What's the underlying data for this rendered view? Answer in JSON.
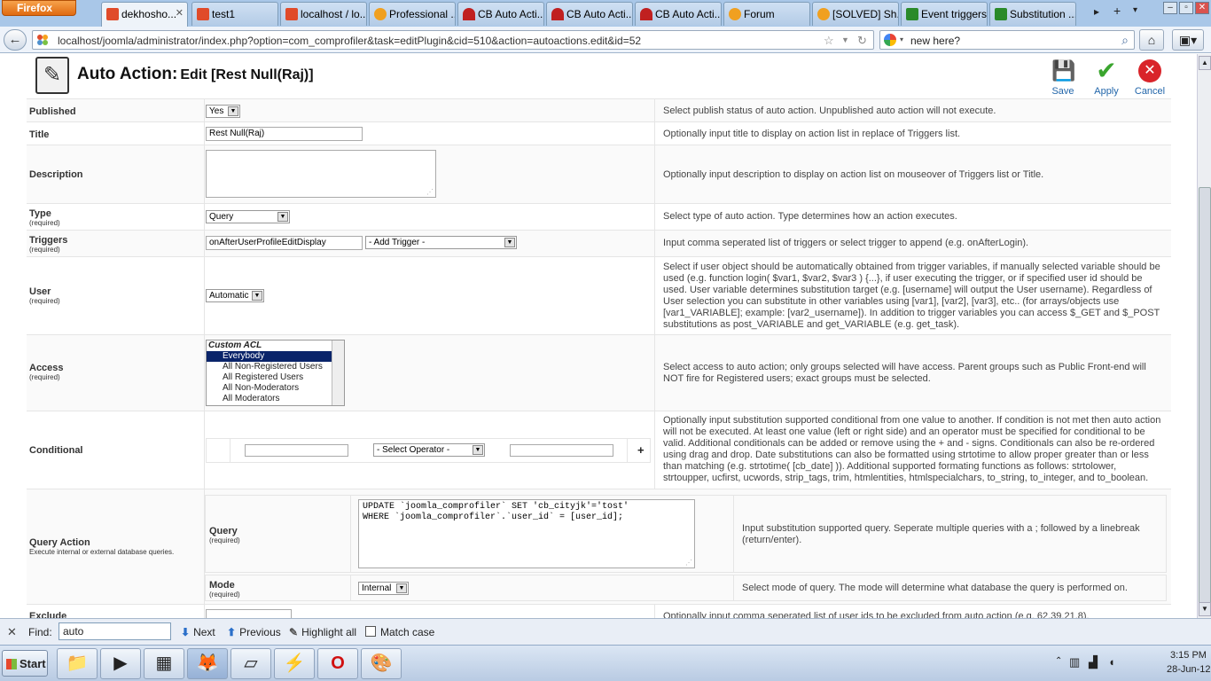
{
  "browser": {
    "menu_button": "Firefox",
    "tabs": [
      {
        "label": "dekhosho...",
        "icon": "joomla-icon",
        "color": "#e04b2a",
        "active": true
      },
      {
        "label": "test1",
        "icon": "joomla-icon",
        "color": "#e04b2a"
      },
      {
        "label": "localhost / lo...",
        "icon": "phpmyadmin-icon",
        "color": "#e04b2a"
      },
      {
        "label": "Professional ...",
        "icon": "forum-icon",
        "color": "#f0a020"
      },
      {
        "label": "CB Auto Acti...",
        "icon": "cb-icon",
        "color": "#c02020"
      },
      {
        "label": "CB Auto Acti...",
        "icon": "cb-icon",
        "color": "#c02020"
      },
      {
        "label": "CB Auto Acti...",
        "icon": "cb-icon",
        "color": "#c02020"
      },
      {
        "label": "Forum",
        "icon": "forum-icon",
        "color": "#f0a020"
      },
      {
        "label": "[SOLVED] Sh...",
        "icon": "forum-icon",
        "color": "#f0a020"
      },
      {
        "label": "Event triggers",
        "icon": "joomla-icon",
        "color": "#2a8a2a"
      },
      {
        "label": "Substitution ...",
        "icon": "joomla-icon",
        "color": "#2a8a2a"
      }
    ],
    "url": "localhost/joomla/administrator/index.php?option=com_comprofiler&task=editPlugin&cid=510&action=autoactions.edit&id=52",
    "search_value": "new here?"
  },
  "page": {
    "title_main": "Auto Action:",
    "title_sub": "Edit [Rest Null(Raj)]",
    "toolbar": {
      "save": "Save",
      "apply": "Apply",
      "cancel": "Cancel"
    },
    "required": "(required)",
    "fields": {
      "published": {
        "label": "Published",
        "value": "Yes",
        "help": "Select publish status of auto action. Unpublished auto action will not execute."
      },
      "title": {
        "label": "Title",
        "value": "Rest Null(Raj)",
        "help": "Optionally input title to display on action list in replace of Triggers list."
      },
      "description": {
        "label": "Description",
        "value": "",
        "help": "Optionally input description to display on action list on mouseover of Triggers list or Title."
      },
      "type": {
        "label": "Type",
        "value": "Query",
        "help": "Select type of auto action. Type determines how an action executes."
      },
      "triggers": {
        "label": "Triggers",
        "value": "onAfterUserProfileEditDisplay",
        "select": "- Add Trigger -",
        "help": "Input comma seperated list of triggers or select trigger to append (e.g. onAfterLogin)."
      },
      "user": {
        "label": "User",
        "value": "Automatic",
        "help": "Select if user object should be automatically obtained from trigger variables, if manually selected variable should be used (e.g. function login( $var1, $var2, $var3 ) {...}, if user executing the trigger, or if specified user id should be used. User variable determines substitution target (e.g. [username] will output the User username). Regardless of User selection you can substitute in other variables using [var1], [var2], [var3], etc.. (for arrays/objects use [var1_VARIABLE]; example: [var2_username]). In addition to trigger variables you can access $_GET and $_POST substitutions as post_VARIABLE and get_VARIABLE (e.g. get_task)."
      },
      "access": {
        "label": "Access",
        "options": [
          "Custom ACL",
          "Everybody",
          "All Non-Registered Users",
          "All Registered Users",
          "All Non-Moderators",
          "All Moderators"
        ],
        "selected": "Everybody",
        "help": "Select access to auto action; only groups selected will have access. Parent groups such as Public Front-end will NOT fire for Registered users; exact groups must be selected."
      },
      "conditional": {
        "label": "Conditional",
        "operator": "- Select Operator -",
        "add": "+",
        "help": "Optionally input substitution supported conditional from one value to another. If condition is not met then auto action will not be executed. At least one value (left or right side) and an operator must be specified for conditional to be valid. Additional conditionals can be added or remove using the + and - signs. Conditionals can also be re-ordered using drag and drop. Date substitutions can also be formatted using strtotime to allow proper greater than or less than matching (e.g. strtotime( [cb_date] )). Additional supported formating functions as follows: strtolower, strtoupper, ucfirst, ucwords, strip_tags, trim, htmlentities, htmlspecialchars, to_string, to_integer, and to_boolean."
      },
      "query_action": {
        "label": "Query Action",
        "sub": "Execute internal or external database queries.",
        "query_label": "Query",
        "query_value": "UPDATE `joomla_comprofiler` SET 'cb_cityjk'='tost'\nWHERE `joomla_comprofiler`.`user_id` = [user_id];",
        "query_help": "Input substitution supported query. Seperate multiple queries with a ; followed by a linebreak (return/enter).",
        "mode_label": "Mode",
        "mode_value": "Internal",
        "mode_help": "Select mode of query. The mode will determine what database the query is performed on."
      },
      "exclude": {
        "label": "Exclude",
        "help": "Optionally input comma seperated list of user ids to be excluded from auto action (e.g. 62,39,21,8)."
      }
    }
  },
  "findbar": {
    "label": "Find:",
    "value": "auto",
    "next": "Next",
    "previous": "Previous",
    "highlight": "Highlight all",
    "match_case": "Match case"
  },
  "taskbar": {
    "start": "Start",
    "apps": [
      "file-explorer-icon",
      "media-player-icon",
      "calculator-icon",
      "firefox-icon",
      "notepad-icon",
      "filezilla-icon",
      "opera-icon",
      "paint-icon"
    ],
    "time": "3:15 PM",
    "date": "28-Jun-12"
  }
}
